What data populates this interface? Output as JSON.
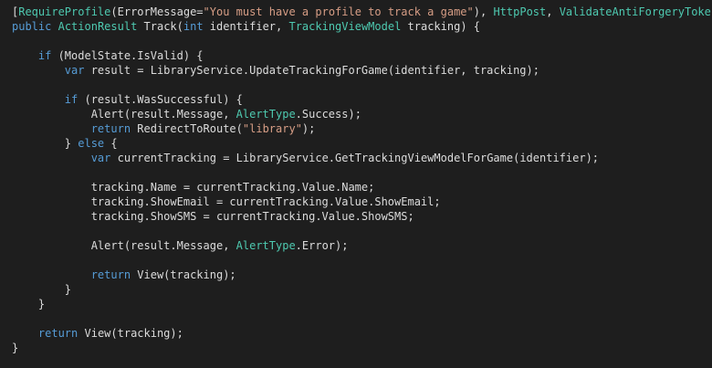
{
  "editor": {
    "background": "#1e1e1e",
    "colors": {
      "plain": "#dcdcdc",
      "keyword": "#569cd6",
      "type": "#4ec9b0",
      "string": "#d69d85"
    },
    "lines": [
      [
        [
          "punct",
          "["
        ],
        [
          "type",
          "RequireProfile"
        ],
        [
          "punct",
          "(ErrorMessage="
        ],
        [
          "string",
          "\"You must have a profile to track a game\""
        ],
        [
          "punct",
          "), "
        ],
        [
          "type",
          "HttpPost"
        ],
        [
          "punct",
          ", "
        ],
        [
          "type",
          "ValidateAntiForgeryToken"
        ],
        [
          "punct",
          "]"
        ]
      ],
      [
        [
          "keyword",
          "public"
        ],
        [
          "plain",
          " "
        ],
        [
          "type",
          "ActionResult"
        ],
        [
          "plain",
          " Track("
        ],
        [
          "keyword",
          "int"
        ],
        [
          "plain",
          " identifier, "
        ],
        [
          "type",
          "TrackingViewModel"
        ],
        [
          "plain",
          " tracking) {"
        ]
      ],
      [],
      [
        [
          "plain",
          "    "
        ],
        [
          "keyword",
          "if"
        ],
        [
          "plain",
          " (ModelState.IsValid) {"
        ]
      ],
      [
        [
          "plain",
          "        "
        ],
        [
          "keyword",
          "var"
        ],
        [
          "plain",
          " result = LibraryService.UpdateTrackingForGame(identifier, tracking);"
        ]
      ],
      [],
      [
        [
          "plain",
          "        "
        ],
        [
          "keyword",
          "if"
        ],
        [
          "plain",
          " (result.WasSuccessful) {"
        ]
      ],
      [
        [
          "plain",
          "            Alert(result.Message, "
        ],
        [
          "type",
          "AlertType"
        ],
        [
          "plain",
          ".Success);"
        ]
      ],
      [
        [
          "plain",
          "            "
        ],
        [
          "keyword",
          "return"
        ],
        [
          "plain",
          " RedirectToRoute("
        ],
        [
          "string",
          "\"library\""
        ],
        [
          "plain",
          ");"
        ]
      ],
      [
        [
          "plain",
          "        } "
        ],
        [
          "keyword",
          "else"
        ],
        [
          "plain",
          " {"
        ]
      ],
      [
        [
          "plain",
          "            "
        ],
        [
          "keyword",
          "var"
        ],
        [
          "plain",
          " currentTracking = LibraryService.GetTrackingViewModelForGame(identifier);"
        ]
      ],
      [],
      [
        [
          "plain",
          "            tracking.Name = currentTracking.Value.Name;"
        ]
      ],
      [
        [
          "plain",
          "            tracking.ShowEmail = currentTracking.Value.ShowEmail;"
        ]
      ],
      [
        [
          "plain",
          "            tracking.ShowSMS = currentTracking.Value.ShowSMS;"
        ]
      ],
      [],
      [
        [
          "plain",
          "            Alert(result.Message, "
        ],
        [
          "type",
          "AlertType"
        ],
        [
          "plain",
          ".Error);"
        ]
      ],
      [],
      [
        [
          "plain",
          "            "
        ],
        [
          "keyword",
          "return"
        ],
        [
          "plain",
          " View(tracking);"
        ]
      ],
      [
        [
          "plain",
          "        }"
        ]
      ],
      [
        [
          "plain",
          "    }"
        ]
      ],
      [],
      [
        [
          "plain",
          "    "
        ],
        [
          "keyword",
          "return"
        ],
        [
          "plain",
          " View(tracking);"
        ]
      ],
      [
        [
          "plain",
          "}"
        ]
      ]
    ]
  }
}
